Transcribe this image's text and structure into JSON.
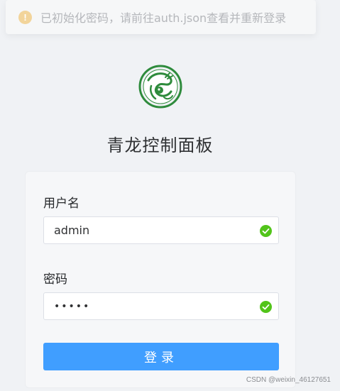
{
  "toast": {
    "icon": "warning-icon",
    "text": "已初始化密码，请前往auth.json查看并重新登录",
    "icon_color": "#f2d49a"
  },
  "logo": {
    "icon": "qinglong-dragon-logo",
    "color": "#2e8b3c"
  },
  "title": "青龙控制面板",
  "form": {
    "username_label": "用户名",
    "username_value": "admin",
    "password_label": "密码",
    "password_value": "•••••",
    "submit_label": "登录",
    "valid_icon": "check-circle-icon",
    "valid_color": "#52c41a",
    "button_color": "#409eff"
  },
  "watermark": "CSDN @weixin_46127651"
}
